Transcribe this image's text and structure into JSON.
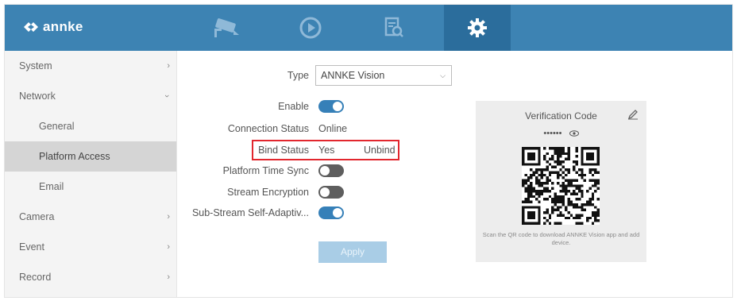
{
  "header": {
    "brand": "annke",
    "tabs": [
      {
        "name": "live-view",
        "icon": "camera-icon",
        "active": false
      },
      {
        "name": "playback",
        "icon": "playback-icon",
        "active": false
      },
      {
        "name": "search",
        "icon": "file-search-icon",
        "active": false
      },
      {
        "name": "configuration",
        "icon": "gear-icon",
        "active": true
      }
    ],
    "colors": {
      "bar": "#3d83b3",
      "active_tab": "#2b6d9c"
    }
  },
  "sidebar": {
    "items": [
      {
        "label": "System",
        "chevron": "right"
      },
      {
        "label": "Network",
        "chevron": "down"
      },
      {
        "label": "General",
        "sub": true
      },
      {
        "label": "Platform Access",
        "sub": true,
        "active": true
      },
      {
        "label": "Email",
        "sub": true
      },
      {
        "label": "Camera",
        "chevron": "right"
      },
      {
        "label": "Event",
        "chevron": "right"
      },
      {
        "label": "Record",
        "chevron": "right"
      }
    ]
  },
  "form": {
    "type_label": "Type",
    "type_value": "ANNKE Vision",
    "enable_label": "Enable",
    "enable_on": true,
    "connection_label": "Connection Status",
    "connection_value": "Online",
    "bind_label": "Bind Status",
    "bind_value": "Yes",
    "unbind_label": "Unbind",
    "time_sync_label": "Platform Time Sync",
    "time_sync_on": false,
    "encryption_label": "Stream Encryption",
    "encryption_on": false,
    "substream_label": "Sub-Stream Self-Adaptiv...",
    "substream_on": true,
    "apply_label": "Apply"
  },
  "verification": {
    "title": "Verification Code",
    "code_masked": "••••••",
    "hint": "Scan the QR code to download ANNKE Vision app and add device."
  }
}
